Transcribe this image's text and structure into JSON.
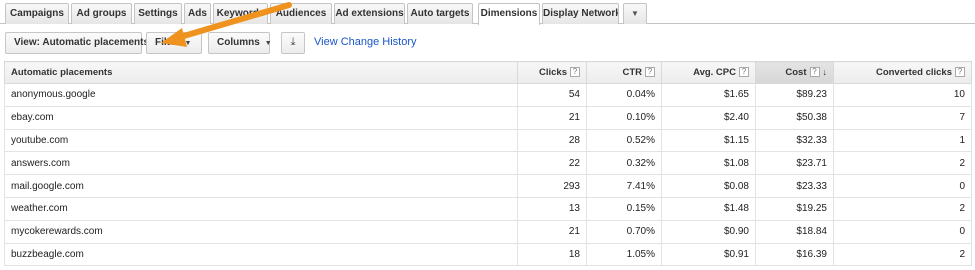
{
  "tabs": [
    {
      "label": "Campaigns"
    },
    {
      "label": "Ad groups"
    },
    {
      "label": "Settings"
    },
    {
      "label": "Ads"
    },
    {
      "label": "Keywords"
    },
    {
      "label": "Audiences"
    },
    {
      "label": "Ad extensions"
    },
    {
      "label": "Auto targets"
    },
    {
      "label": "Dimensions"
    },
    {
      "label": "Display Network"
    }
  ],
  "active_tab": "Dimensions",
  "toolbar": {
    "view_label": "View: Automatic placements",
    "filter_label": "Filter",
    "columns_label": "Columns",
    "download_icon": "download-icon",
    "change_history_link": "View Change History"
  },
  "table": {
    "columns": [
      "Automatic placements",
      "Clicks",
      "CTR",
      "Avg. CPC",
      "Cost",
      "Converted clicks"
    ],
    "sorted_column": "Cost",
    "rows": [
      {
        "placement": "anonymous.google",
        "clicks": "54",
        "ctr": "0.04%",
        "cpc": "$1.65",
        "cost": "$89.23",
        "converted": "10"
      },
      {
        "placement": "ebay.com",
        "clicks": "21",
        "ctr": "0.10%",
        "cpc": "$2.40",
        "cost": "$50.38",
        "converted": "7"
      },
      {
        "placement": "youtube.com",
        "clicks": "28",
        "ctr": "0.52%",
        "cpc": "$1.15",
        "cost": "$32.33",
        "converted": "1"
      },
      {
        "placement": "answers.com",
        "clicks": "22",
        "ctr": "0.32%",
        "cpc": "$1.08",
        "cost": "$23.71",
        "converted": "2"
      },
      {
        "placement": "mail.google.com",
        "clicks": "293",
        "ctr": "7.41%",
        "cpc": "$0.08",
        "cost": "$23.33",
        "converted": "0"
      },
      {
        "placement": "weather.com",
        "clicks": "13",
        "ctr": "0.15%",
        "cpc": "$1.48",
        "cost": "$19.25",
        "converted": "2"
      },
      {
        "placement": "mycokerewards.com",
        "clicks": "21",
        "ctr": "0.70%",
        "cpc": "$0.90",
        "cost": "$18.84",
        "converted": "0"
      },
      {
        "placement": "buzzbeagle.com",
        "clicks": "18",
        "ctr": "1.05%",
        "cpc": "$0.91",
        "cost": "$16.39",
        "converted": "2"
      }
    ]
  },
  "colors": {
    "link": "#1a55c9",
    "annotation_arrow": "#f0921e"
  }
}
